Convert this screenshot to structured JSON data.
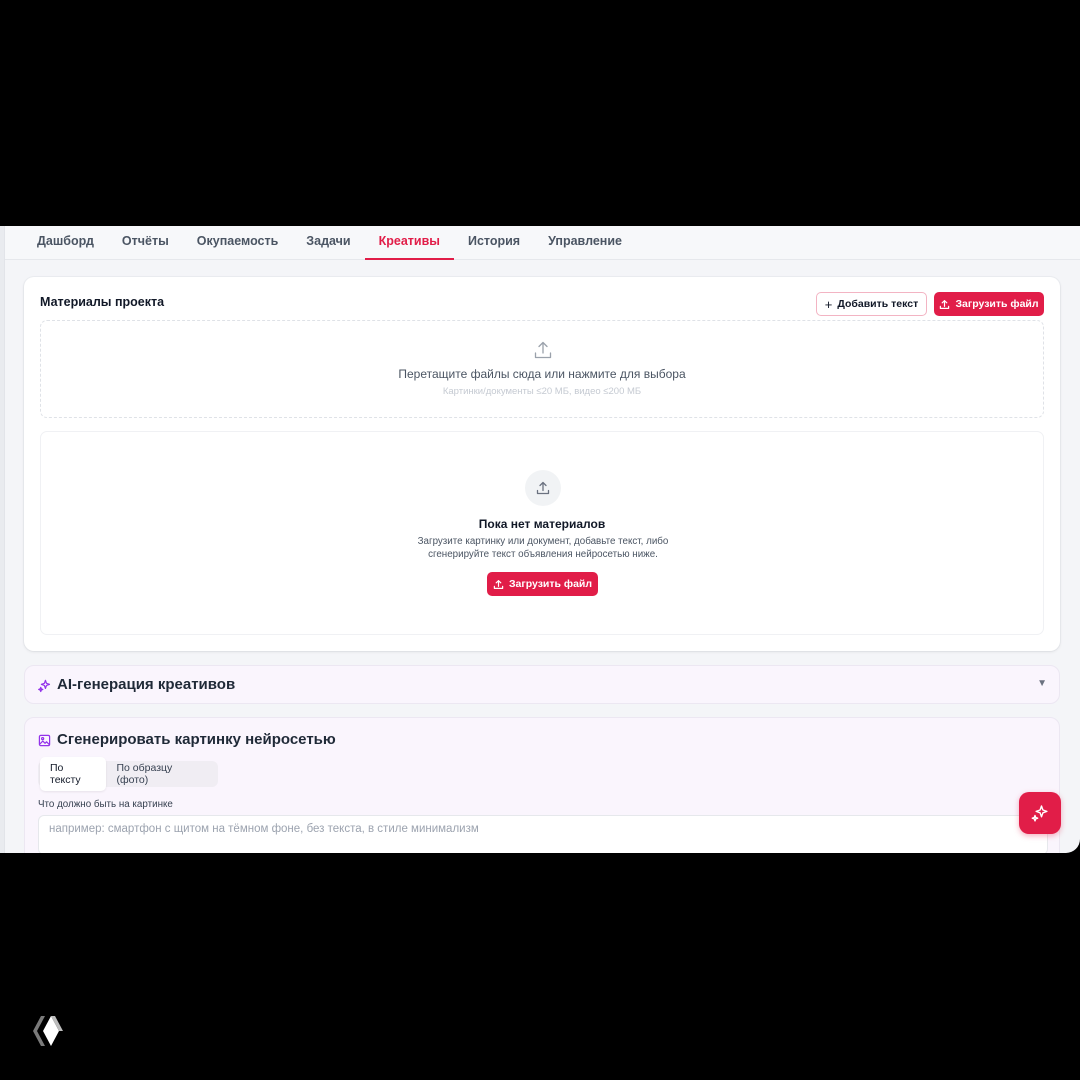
{
  "tabs": [
    {
      "label": "Дашборд",
      "active": false
    },
    {
      "label": "Отчёты",
      "active": false
    },
    {
      "label": "Окупаемость",
      "active": false
    },
    {
      "label": "Задачи",
      "active": false
    },
    {
      "label": "Креативы",
      "active": true
    },
    {
      "label": "История",
      "active": false
    },
    {
      "label": "Управление",
      "active": false
    }
  ],
  "materials": {
    "title": "Материалы проекта",
    "add_text_label": "Добавить текст",
    "upload_label": "Загрузить файл",
    "dropzone_text": "Перетащите файлы сюда или нажмите для выбора",
    "dropzone_hint": "Картинки/документы ≤20 МБ, видео ≤200 МБ",
    "empty_title": "Пока нет материалов",
    "empty_desc": "Загрузите картинку или документ, добавьте текст, либо сгенерируйте текст объявления нейросетью ниже.",
    "empty_upload_label": "Загрузить файл"
  },
  "ai_section": {
    "title": "AI-генерация креативов",
    "icon": "sparkles-icon",
    "chevron": "▼"
  },
  "image_gen": {
    "title": "Сгенерировать картинку нейросетью",
    "icon": "image-icon",
    "modes": [
      {
        "label": "По тексту",
        "active": true
      },
      {
        "label": "По образцу (фото)",
        "active": false
      }
    ],
    "prompt_label": "Что должно быть на картинке",
    "prompt_placeholder": "например: смартфон с щитом на тёмном фоне, без текста, в стиле минимализм",
    "prompt_value": ""
  },
  "colors": {
    "accent": "#e11d48",
    "ai_bg": "#faf5fd",
    "page_bg": "#f4f5f8"
  }
}
